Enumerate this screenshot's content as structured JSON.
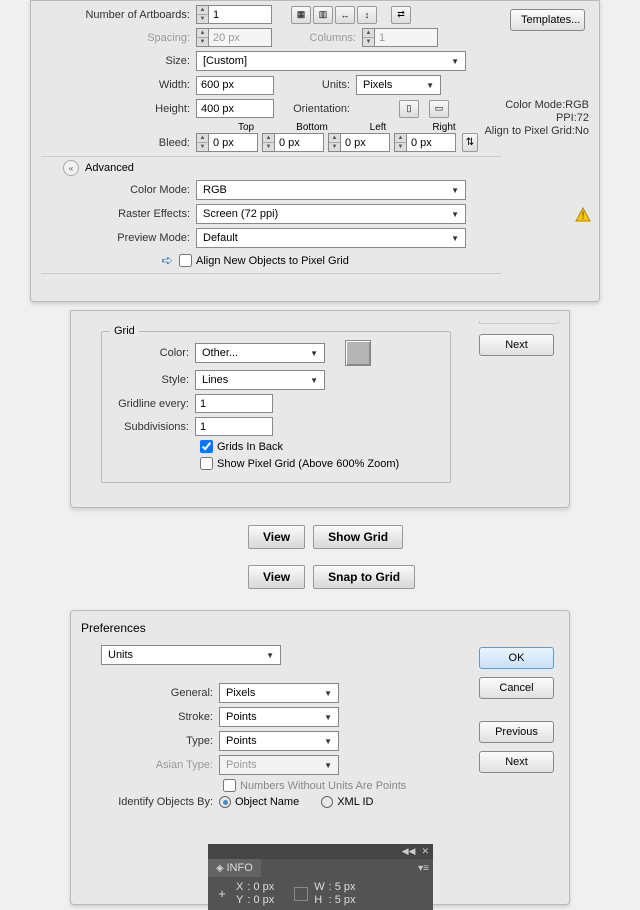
{
  "panel1": {
    "artboards_label": "Number of Artboards:",
    "artboards_value": "1",
    "spacing_label": "Spacing:",
    "spacing_value": "20 px",
    "columns_label": "Columns:",
    "columns_value": "1",
    "size_label": "Size:",
    "size_value": "[Custom]",
    "width_label": "Width:",
    "width_value": "600 px",
    "units_label": "Units:",
    "units_value": "Pixels",
    "height_label": "Height:",
    "height_value": "400 px",
    "orientation_label": "Orientation:",
    "bleed_label": "Bleed:",
    "bleed_top_label": "Top",
    "bleed_bottom_label": "Bottom",
    "bleed_left_label": "Left",
    "bleed_right_label": "Right",
    "bleed_top": "0 px",
    "bleed_bottom": "0 px",
    "bleed_left": "0 px",
    "bleed_right": "0 px",
    "advanced_label": "Advanced",
    "color_mode_label": "Color Mode:",
    "color_mode_value": "RGB",
    "raster_label": "Raster Effects:",
    "raster_value": "Screen (72 ppi)",
    "preview_label": "Preview Mode:",
    "preview_value": "Default",
    "align_label": "Align New Objects to Pixel Grid",
    "templates_btn": "Templates...",
    "side": {
      "color_mode": "Color Mode:RGB",
      "ppi": "PPI:72",
      "align": "Align to Pixel Grid:No"
    }
  },
  "panel2": {
    "title": "Grid",
    "color_label": "Color:",
    "color_value": "Other...",
    "style_label": "Style:",
    "style_value": "Lines",
    "gridline_label": "Gridline every:",
    "gridline_value": "1",
    "subdiv_label": "Subdivisions:",
    "subdiv_value": "1",
    "grids_back": "Grids In Back",
    "show_pixel": "Show Pixel Grid (Above 600% Zoom)",
    "next_btn": "Next"
  },
  "menubar": {
    "view1": "View",
    "showgrid": "Show Grid",
    "view2": "View",
    "snapgrid": "Snap to Grid"
  },
  "panel3": {
    "title": "Preferences",
    "units_tab": "Units",
    "general_label": "General:",
    "general_value": "Pixels",
    "stroke_label": "Stroke:",
    "stroke_value": "Points",
    "type_label": "Type:",
    "type_value": "Points",
    "asian_label": "Asian Type:",
    "asian_value": "Points",
    "numbers_label": "Numbers Without Units Are Points",
    "identify_label": "Identify Objects By:",
    "obj_name": "Object Name",
    "xml_id": "XML ID",
    "ok_btn": "OK",
    "cancel_btn": "Cancel",
    "prev_btn": "Previous",
    "next_btn": "Next"
  },
  "info": {
    "tab": "INFO",
    "x_label": "X",
    "x_value": ": 0 px",
    "y_label": "Y",
    "y_value": ": 0 px",
    "w_label": "W",
    "w_value": ": 5 px",
    "h_label": "H",
    "h_value": ": 5 px"
  }
}
